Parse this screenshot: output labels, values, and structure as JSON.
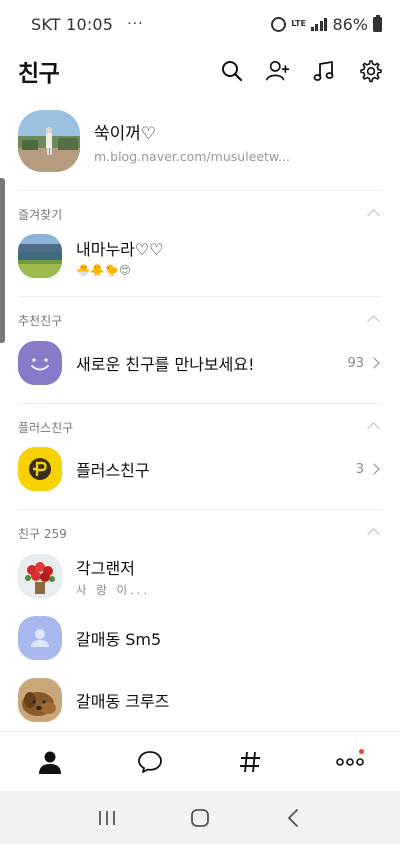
{
  "status_bar": {
    "carrier_time": "SKT 10:05",
    "more": "···",
    "network": "LTE",
    "battery": "86%"
  },
  "header": {
    "title": "친구",
    "icons": [
      "search-icon",
      "add-friend-icon",
      "music-icon",
      "settings-icon"
    ]
  },
  "profile": {
    "name": "쑥이꺼♡",
    "status_message": "m.blog.naver.com/musuleetw..."
  },
  "sections": {
    "favorites": {
      "label": "즐겨찾기",
      "items": [
        {
          "name": "내마누라♡♡",
          "status": "🐣🐥🐤😍"
        }
      ]
    },
    "recommended": {
      "label": "추천친구",
      "items": [
        {
          "name": "새로운 친구를 만나보세요!",
          "count": "93"
        }
      ]
    },
    "plus_friends": {
      "label": "플러스친구",
      "items": [
        {
          "name": "플러스친구",
          "count": "3"
        }
      ]
    },
    "friends": {
      "label": "친구 259",
      "items": [
        {
          "name": "각그랜저",
          "status": "사 랑 이..."
        },
        {
          "name": "갈매동 Sm5"
        },
        {
          "name": "갈매동 크루즈"
        }
      ]
    }
  },
  "tabs": [
    "friends-tab",
    "chats-tab",
    "hashtag-tab",
    "more-tab"
  ],
  "colors": {
    "recommend_avatar": "#8a78c9",
    "plus_avatar": "#f7d100",
    "default_avatar": "#a8b8ee",
    "badge": "#f0442c"
  }
}
